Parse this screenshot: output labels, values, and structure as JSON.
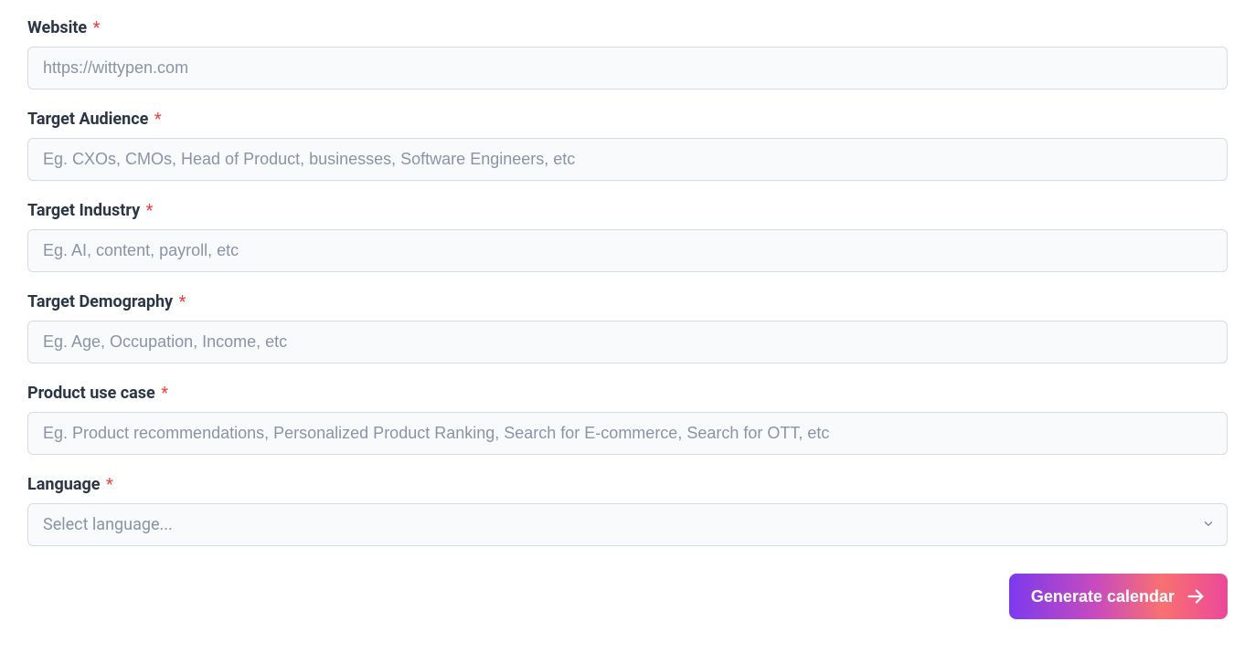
{
  "fields": {
    "website": {
      "label": "Website",
      "placeholder": "https://wittypen.com",
      "required": "*"
    },
    "target_audience": {
      "label": "Target Audience",
      "placeholder": "Eg. CXOs, CMOs, Head of Product, businesses, Software Engineers, etc",
      "required": "*"
    },
    "target_industry": {
      "label": "Target Industry",
      "placeholder": "Eg. AI, content, payroll, etc",
      "required": "*"
    },
    "target_demography": {
      "label": "Target Demography",
      "placeholder": "Eg. Age, Occupation, Income, etc",
      "required": "*"
    },
    "product_use_case": {
      "label": "Product use case",
      "placeholder": "Eg. Product recommendations, Personalized Product Ranking, Search for E-commerce, Search for OTT, etc",
      "required": "*"
    },
    "language": {
      "label": "Language",
      "placeholder": "Select language...",
      "required": "*"
    }
  },
  "actions": {
    "generate_label": "Generate calendar"
  }
}
